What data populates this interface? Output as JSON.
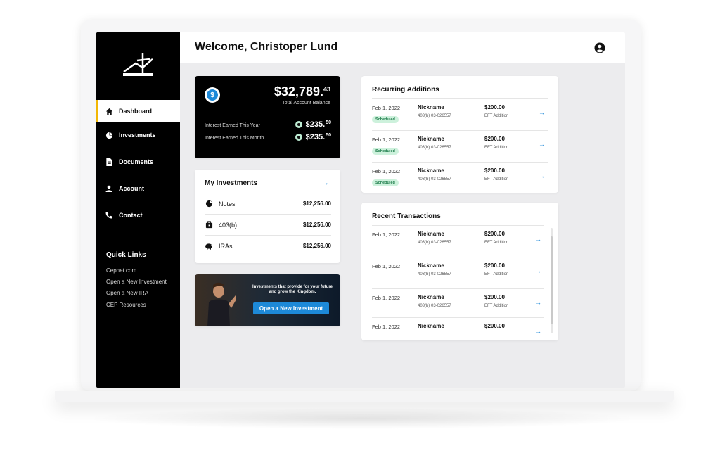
{
  "sidebar": {
    "logo": "cep-logo",
    "items": [
      {
        "label": "Dashboard",
        "icon": "home-icon",
        "active": true
      },
      {
        "label": "Investments",
        "icon": "pie-chart-icon"
      },
      {
        "label": "Documents",
        "icon": "document-icon"
      },
      {
        "label": "Account",
        "icon": "user-icon"
      },
      {
        "label": "Contact",
        "icon": "phone-icon"
      }
    ],
    "quick_links_title": "Quick Links",
    "quick_links": [
      "Cepnet.com",
      "Open a New Investment",
      "Open a New IRA",
      "CEP Resources"
    ]
  },
  "header": {
    "title": "Welcome, Christoper Lund"
  },
  "balance": {
    "amount_main": "$32,789.",
    "amount_cents": "43",
    "label": "Total Account Balance",
    "rows": [
      {
        "label": "Interest Earned This Year",
        "main": "$235.",
        "cents": "50"
      },
      {
        "label": "Interest Earned This Month",
        "main": "$235.",
        "cents": "50"
      }
    ]
  },
  "investments": {
    "title": "My Investments",
    "rows": [
      {
        "label": "Notes",
        "amount": "$12,256.00",
        "icon": "pie-chart-icon"
      },
      {
        "label": "403(b)",
        "amount": "$12,256.00",
        "icon": "briefcase-icon"
      },
      {
        "label": "IRAs",
        "amount": "$12,256.00",
        "icon": "piggy-bank-icon"
      }
    ]
  },
  "promo": {
    "text": "Investments that provide for your future and grow the Kingdom.",
    "button": "Open a New Investment"
  },
  "recurring": {
    "title": "Recurring Additions",
    "rows": [
      {
        "date": "Feb 1, 2022",
        "badge": "Scheduled",
        "name": "Nickname",
        "acct": "403(b)    03-026557",
        "amount": "$200.00",
        "type": "EFT Addition"
      },
      {
        "date": "Feb 1, 2022",
        "badge": "Scheduled",
        "name": "Nickname",
        "acct": "403(b)    03-026557",
        "amount": "$200.00",
        "type": "EFT Addition"
      },
      {
        "date": "Feb 1, 2022",
        "badge": "Scheduled",
        "name": "Nickname",
        "acct": "403(b)    03-026557",
        "amount": "$200.00",
        "type": "EFT Addition"
      }
    ]
  },
  "transactions": {
    "title": "Recent Transactions",
    "rows": [
      {
        "date": "Feb 1, 2022",
        "name": "Nickname",
        "acct": "403(b)    03-026557",
        "amount": "$200.00",
        "type": "EFT Addition"
      },
      {
        "date": "Feb 1, 2022",
        "name": "Nickname",
        "acct": "403(b)    03-026557",
        "amount": "$200.00",
        "type": "EFT Addition"
      },
      {
        "date": "Feb 1, 2022",
        "name": "Nickname",
        "acct": "403(b)    03-026557",
        "amount": "$200.00",
        "type": "EFT Addition"
      },
      {
        "date": "Feb 1, 2022",
        "name": "Nickname",
        "acct": "",
        "amount": "$200.00",
        "type": ""
      }
    ]
  },
  "colors": {
    "accent": "#1d89d8",
    "active_marker": "#f2b705",
    "scheduled_bg": "#cdf1dc"
  }
}
